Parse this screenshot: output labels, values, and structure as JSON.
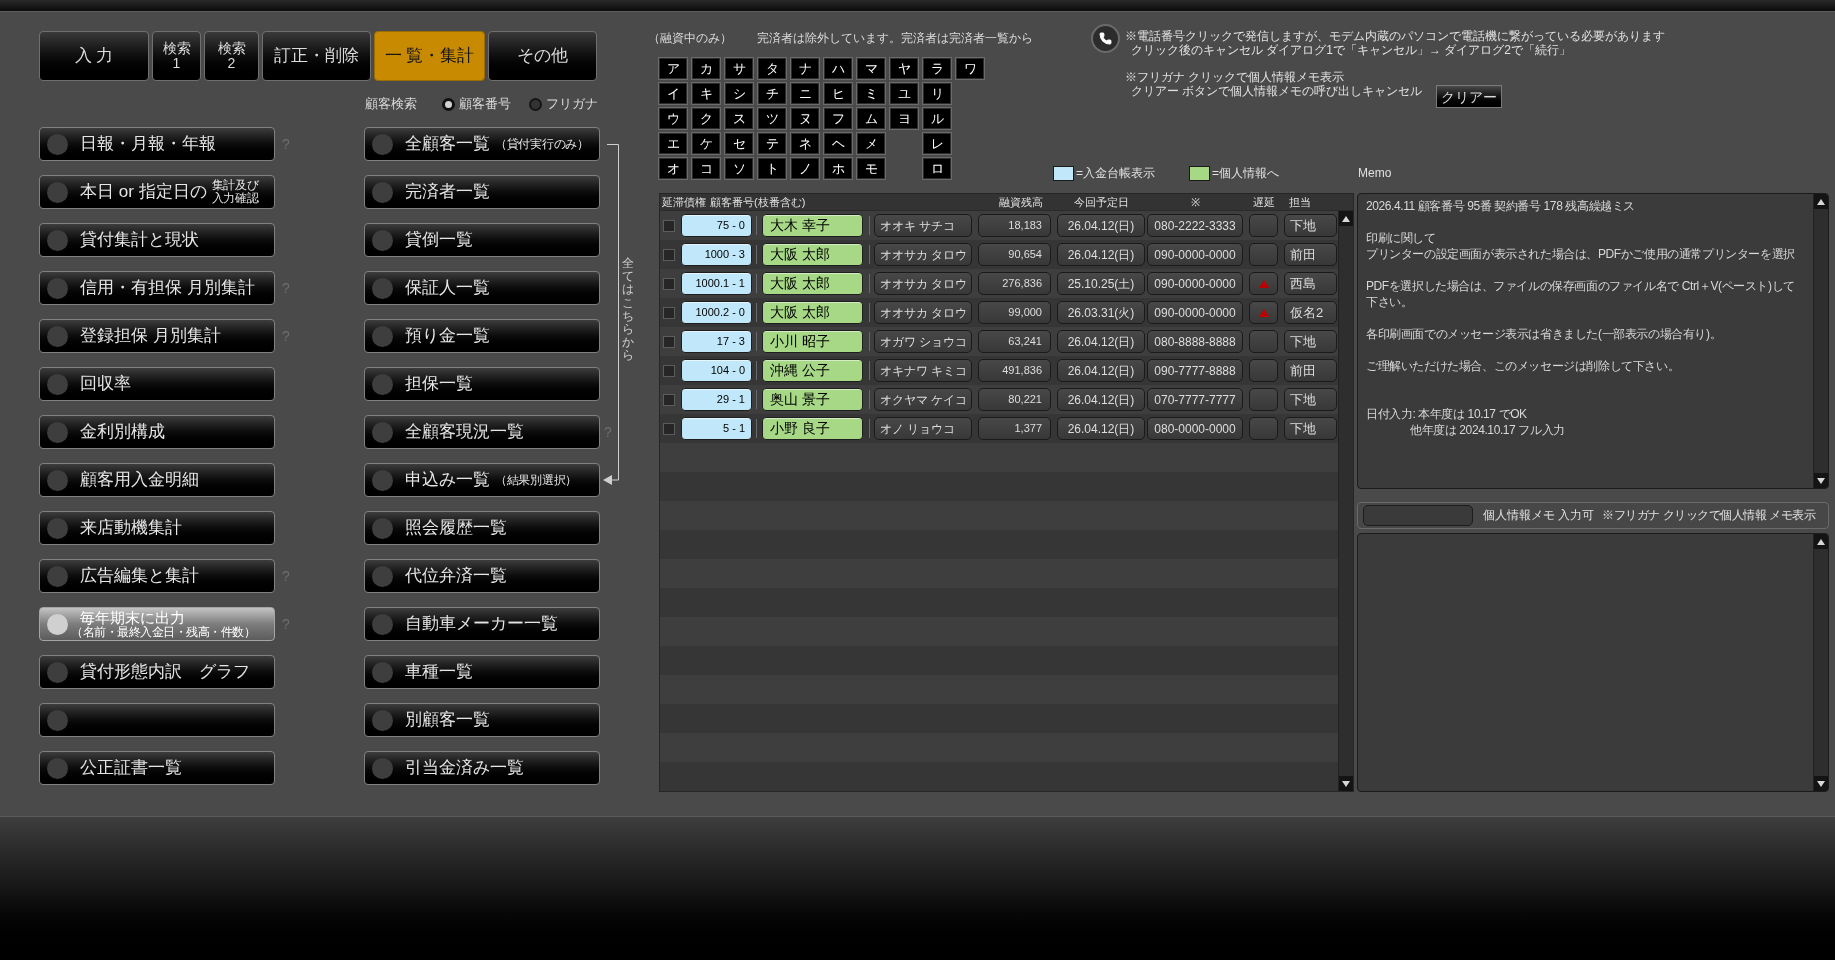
{
  "tabs": [
    {
      "lines": [
        "入 力"
      ],
      "selected": false
    },
    {
      "lines": [
        "検索",
        "1"
      ],
      "selected": false
    },
    {
      "lines": [
        "検索",
        "2"
      ],
      "selected": false
    },
    {
      "lines": [
        "訂正・削除"
      ],
      "selected": false
    },
    {
      "lines": [
        "一 覧・集計"
      ],
      "selected": true
    },
    {
      "lines": [
        "その他"
      ],
      "selected": false
    }
  ],
  "customer_search": {
    "label": "顧客検索",
    "options": [
      {
        "label": "顧客番号",
        "selected": true
      },
      {
        "label": "フリガナ",
        "selected": false
      }
    ]
  },
  "menu_left": [
    {
      "label": "日報・月報・年報",
      "selected": false,
      "hint": "?"
    },
    {
      "label": "本日 or 指定日の",
      "note": [
        "集計及び",
        "入力確認"
      ],
      "selected": false
    },
    {
      "label": "貸付集計と現状",
      "selected": false
    },
    {
      "label": "信用・有担保 月別集計",
      "selected": false,
      "hint": "?"
    },
    {
      "label": "登録担保 月別集計",
      "selected": false,
      "hint": "?"
    },
    {
      "label": "回収率",
      "selected": false
    },
    {
      "label": "金利別構成",
      "selected": false
    },
    {
      "label": "顧客用入金明細",
      "selected": false
    },
    {
      "label": "来店動機集計",
      "selected": false
    },
    {
      "label": "広告編集と集計",
      "selected": false,
      "hint": "?"
    },
    {
      "label": "毎年期末に出力",
      "subline": "（名前・最終入金日・残高・件数）",
      "selected": true,
      "hint": "?"
    },
    {
      "label": "貸付形態内訳　グラフ",
      "selected": false
    },
    {
      "selected": false
    },
    {
      "label": "公正証書一覧",
      "selected": false
    }
  ],
  "menu_right": [
    {
      "label": "全顧客一覧",
      "note": [
        "（貸付実行のみ）"
      ],
      "selected": false
    },
    {
      "label": "完済者一覧",
      "selected": false
    },
    {
      "label": "貸倒一覧",
      "selected": false
    },
    {
      "label": "保証人一覧",
      "selected": false
    },
    {
      "label": "預り金一覧",
      "selected": false
    },
    {
      "label": "担保一覧",
      "selected": false
    },
    {
      "label": "全顧客現況一覧",
      "selected": false,
      "hint": "?"
    },
    {
      "label": "申込み一覧",
      "note": [
        "（結果別選択）"
      ],
      "selected": false
    },
    {
      "label": "照会履歴一覧",
      "selected": false
    },
    {
      "label": "代位弁済一覧",
      "selected": false
    },
    {
      "label": "自動車メーカー一覧",
      "selected": false
    },
    {
      "label": "車種一覧",
      "selected": false
    },
    {
      "label": "別顧客一覧",
      "selected": false
    },
    {
      "label": "引当金済み一覧",
      "selected": false
    }
  ],
  "bracket_caption": "全てはこちらから",
  "list_header": {
    "filter": "（融資中のみ）",
    "note": "完済者は除外しています。完済者は完済者一覧から"
  },
  "kana_columns": [
    [
      "ア",
      "イ",
      "ウ",
      "エ",
      "オ"
    ],
    [
      "カ",
      "キ",
      "ク",
      "ケ",
      "コ"
    ],
    [
      "サ",
      "シ",
      "ス",
      "セ",
      "ソ"
    ],
    [
      "タ",
      "チ",
      "ツ",
      "テ",
      "ト"
    ],
    [
      "ナ",
      "ニ",
      "ヌ",
      "ネ",
      "ノ"
    ],
    [
      "ハ",
      "ヒ",
      "フ",
      "ヘ",
      "ホ"
    ],
    [
      "マ",
      "ミ",
      "ム",
      "メ",
      "モ"
    ],
    [
      "ヤ",
      "ユ",
      "ヨ"
    ],
    [
      "ラ",
      "リ",
      "ル",
      "レ",
      "ロ"
    ],
    [
      "ワ"
    ]
  ],
  "notes": [
    {
      "lines": [
        "※電話番号クリックで発信しますが、モデム内蔵のパソコンで電話機に繋がっている必要があります",
        "クリック後のキャンセル ダイアログ1で「キャンセル」→ ダイアログ2で「続行」"
      ]
    },
    {
      "lines": [
        "※フリガナ クリックで個人情報メモ表示",
        "クリアー ボタンで個人情報メモの呼び出しキャンセル"
      ]
    }
  ],
  "clear_button": "クリアー",
  "legend": [
    {
      "color": "#c0e8fa",
      "label": "=入金台帳表示"
    },
    {
      "color": "#a6d886",
      "label": "=個人情報へ"
    }
  ],
  "table": {
    "columns": [
      "延滞債権",
      "顧客番号(枝番含む)",
      "融資残高",
      "今回予定日",
      "※",
      "遅延",
      "担当"
    ],
    "rows": [
      {
        "checked": false,
        "customer_no": "75 - 0",
        "name": "大木 幸子",
        "kana": "オオキ サチコ",
        "balance": "18,183",
        "due_date": "26.04.12(日)",
        "phone": "080-2222-3333",
        "delayed": false,
        "staff": "下地"
      },
      {
        "checked": false,
        "customer_no": "1000 - 3",
        "name": "大阪 太郎",
        "kana": "オオサカ タロウ",
        "balance": "90,654",
        "due_date": "26.04.12(日)",
        "phone": "090-0000-0000",
        "delayed": false,
        "staff": "前田"
      },
      {
        "checked": false,
        "customer_no": "1000.1 - 1",
        "name": "大阪 太郎",
        "kana": "オオサカ タロウ",
        "balance": "276,836",
        "due_date": "25.10.25(土)",
        "phone": "090-0000-0000",
        "delayed": true,
        "staff": "西島"
      },
      {
        "checked": false,
        "customer_no": "1000.2 - 0",
        "name": "大阪 太郎",
        "kana": "オオサカ タロウ",
        "balance": "99,000",
        "due_date": "26.03.31(火)",
        "phone": "090-0000-0000",
        "delayed": true,
        "staff": "仮名2"
      },
      {
        "checked": false,
        "customer_no": "17 - 3",
        "name": "小川 昭子",
        "kana": "オガワ ショウコ",
        "balance": "63,241",
        "due_date": "26.04.12(日)",
        "phone": "080-8888-8888",
        "delayed": false,
        "staff": "下地"
      },
      {
        "checked": false,
        "customer_no": "104 - 0",
        "name": "沖縄 公子",
        "kana": "オキナワ キミコ",
        "balance": "491,836",
        "due_date": "26.04.12(日)",
        "phone": "090-7777-8888",
        "delayed": false,
        "staff": "前田"
      },
      {
        "checked": false,
        "customer_no": "29 - 1",
        "name": "奥山 景子",
        "kana": "オクヤマ ケイコ",
        "balance": "80,221",
        "due_date": "26.04.12(日)",
        "phone": "070-7777-7777",
        "delayed": false,
        "staff": "下地"
      },
      {
        "checked": false,
        "customer_no": "5 - 1",
        "name": "小野 良子",
        "kana": "オノ リョウコ",
        "balance": "1,377",
        "due_date": "26.04.12(日)",
        "phone": "080-0000-0000",
        "delayed": false,
        "staff": "下地"
      }
    ]
  },
  "memo": {
    "label": "Memo",
    "paragraphs": [
      {
        "kind": "plain",
        "lines": [
          "2026.4.11 顧客番号 95番 契約番号 178 残高繰越ミス"
        ]
      },
      {
        "kind": "plain",
        "lines": [
          "印刷に関して",
          "プリンターの設定画面が表示された場合は、PDFかご使用の通常プリンターを選択"
        ]
      },
      {
        "kind": "plain",
        "lines": [
          "PDFを選択した場合は、ファイルの保存画面のファイル名で Ctrl＋V(ペースト)して下さい。"
        ]
      },
      {
        "kind": "plain",
        "lines": [
          "各印刷画面でのメッセージ表示は省きました(一部表示の場合有り)。"
        ]
      },
      {
        "kind": "plain",
        "lines": [
          "ご理解いただけた場合、このメッセージは削除して下さい。"
        ]
      },
      {
        "kind": "indented",
        "lines": [
          "日付入力: 本年度は 10.17 でOK",
          "他年度は 2024.10.17 フル入力"
        ]
      }
    ]
  },
  "personal_memo": {
    "label": "個人情報メモ 入力可",
    "hint": "※フリガナ クリックで個人情報 メモ表示"
  }
}
